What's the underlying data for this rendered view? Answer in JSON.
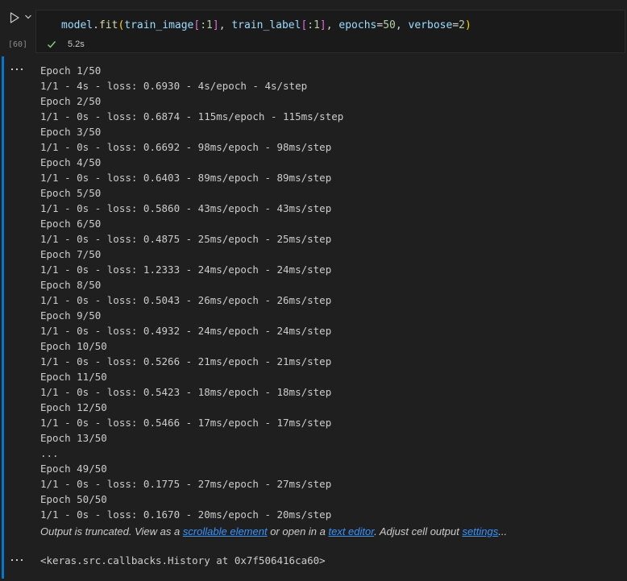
{
  "cell": {
    "execution_count": "[60]",
    "code": {
      "t1": "model",
      "t2": ".",
      "t3": "fit",
      "t4": "(",
      "t5": "train_image",
      "t6": "[",
      "t7": ":1",
      "t8": "]",
      "t9": ", ",
      "t10": "train_label",
      "t11": "[",
      "t12": ":1",
      "t13": "]",
      "t14": ", ",
      "t15": "epochs",
      "t16": "=",
      "t17": "50",
      "t18": ", ",
      "t19": "verbose",
      "t20": "=",
      "t21": "2",
      "t22": ")"
    },
    "duration": "5.2s",
    "status": "success"
  },
  "output": {
    "lines": [
      "Epoch 1/50",
      "1/1 - 4s - loss: 0.6930 - 4s/epoch - 4s/step",
      "Epoch 2/50",
      "1/1 - 0s - loss: 0.6874 - 115ms/epoch - 115ms/step",
      "Epoch 3/50",
      "1/1 - 0s - loss: 0.6692 - 98ms/epoch - 98ms/step",
      "Epoch 4/50",
      "1/1 - 0s - loss: 0.6403 - 89ms/epoch - 89ms/step",
      "Epoch 5/50",
      "1/1 - 0s - loss: 0.5860 - 43ms/epoch - 43ms/step",
      "Epoch 6/50",
      "1/1 - 0s - loss: 0.4875 - 25ms/epoch - 25ms/step",
      "Epoch 7/50",
      "1/1 - 0s - loss: 1.2333 - 24ms/epoch - 24ms/step",
      "Epoch 8/50",
      "1/1 - 0s - loss: 0.5043 - 26ms/epoch - 26ms/step",
      "Epoch 9/50",
      "1/1 - 0s - loss: 0.4932 - 24ms/epoch - 24ms/step",
      "Epoch 10/50",
      "1/1 - 0s - loss: 0.5266 - 21ms/epoch - 21ms/step",
      "Epoch 11/50",
      "1/1 - 0s - loss: 0.5423 - 18ms/epoch - 18ms/step",
      "Epoch 12/50",
      "1/1 - 0s - loss: 0.5466 - 17ms/epoch - 17ms/step",
      "Epoch 13/50",
      "...",
      "Epoch 49/50",
      "1/1 - 0s - loss: 0.1775 - 27ms/epoch - 27ms/step",
      "Epoch 50/50",
      "1/1 - 0s - loss: 0.1670 - 20ms/epoch - 20ms/step"
    ],
    "truncation": {
      "prefix": "Output is truncated. View as a ",
      "link_scrollable": "scrollable element",
      "middle": " or open in a ",
      "link_editor": "text editor",
      "middle2": ". Adjust cell output ",
      "link_settings": "settings",
      "suffix": "..."
    },
    "result": "<keras.src.callbacks.History at 0x7f506416ca60>"
  },
  "colors": {
    "background": "#1f1f1f",
    "focus_bar": "#0078d4",
    "check": "#89d185",
    "link": "#3794ff"
  },
  "icons": [
    "run-cell-icon",
    "chevron-down-icon",
    "check-icon",
    "output-menu-icon"
  ]
}
